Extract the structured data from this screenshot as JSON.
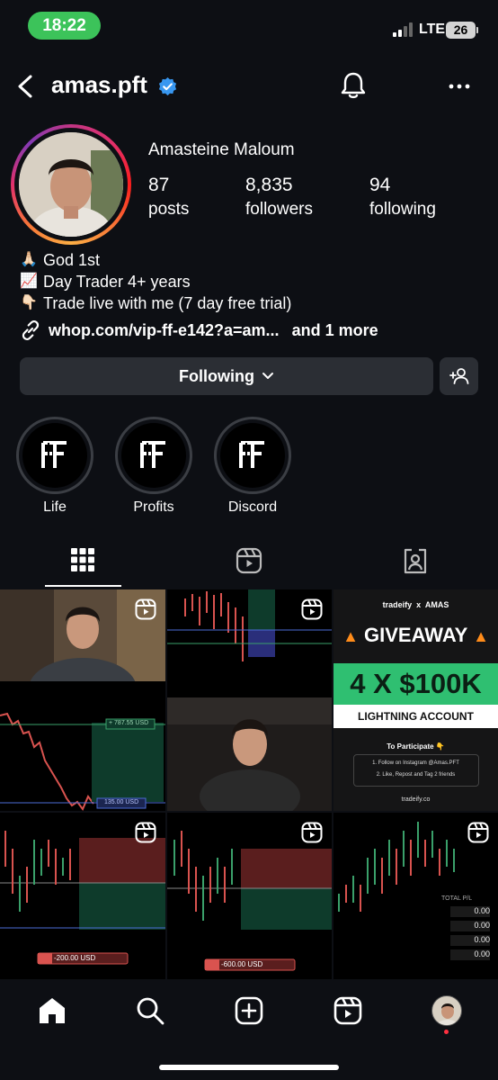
{
  "status_bar": {
    "time": "18:22",
    "network": "LTE",
    "battery": "26"
  },
  "header": {
    "username": "amas.pft"
  },
  "profile": {
    "full_name": "Amasteine Maloum",
    "stats": [
      {
        "value": "87",
        "label": "posts"
      },
      {
        "value": "8,835",
        "label": "followers"
      },
      {
        "value": "94",
        "label": "following"
      }
    ],
    "bio": [
      {
        "emoji": "🙏🏻",
        "text": "God 1st"
      },
      {
        "emoji": "📈",
        "text": "Day Trader 4+ years"
      },
      {
        "emoji": "👇🏻",
        "text": "Trade live with me (7 day free trial)"
      }
    ],
    "link": {
      "text": "whop.com/vip-ff-e142?a=am...",
      "more": "and 1 more"
    }
  },
  "actions": {
    "following_label": "Following"
  },
  "highlights": [
    {
      "label": "Life",
      "logo": "FF"
    },
    {
      "label": "Profits",
      "logo": "FF"
    },
    {
      "label": "Discord",
      "logo": "FF"
    }
  ],
  "grid": {
    "giveaway": {
      "brand": "tradeify",
      "x": "x",
      "partner": "AMAS",
      "headline": "GIVEAWAY",
      "prize": "4 X $100K",
      "account": "LIGHTNING ACCOUNT",
      "participate": "To Participate 👇",
      "step1": "1. Follow on Instagram @Amas.PFT",
      "step2": "2. Like, Repost and Tag 2 friends",
      "site": "tradeify.co"
    },
    "chart_labels": {
      "top_price": "+ 787.55 USD",
      "bottom_price": "135.00 USD",
      "order1": "-200.00 USD",
      "order2": "-600.00 USD",
      "total_pl": "TOTAL P/L",
      "pl_values": [
        "0.00",
        "0.00",
        "0.00",
        "0.00"
      ]
    }
  },
  "colors": {
    "accent_green": "#3cc35a",
    "verified": "#3897f0",
    "bg": "#0d0f14",
    "button": "#2b2e34"
  }
}
